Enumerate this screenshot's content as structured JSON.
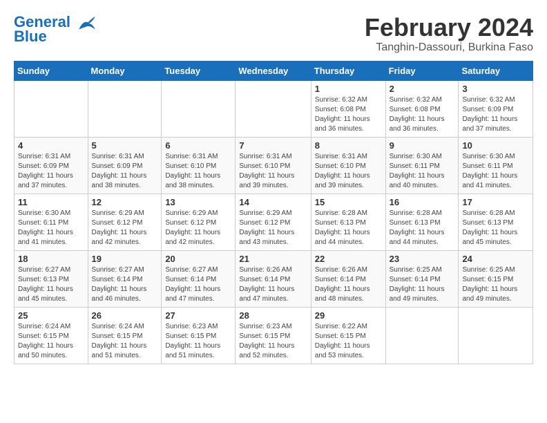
{
  "logo": {
    "line1": "General",
    "line2": "Blue"
  },
  "title": "February 2024",
  "subtitle": "Tanghin-Dassouri, Burkina Faso",
  "weekdays": [
    "Sunday",
    "Monday",
    "Tuesday",
    "Wednesday",
    "Thursday",
    "Friday",
    "Saturday"
  ],
  "weeks": [
    [
      {
        "day": "",
        "info": ""
      },
      {
        "day": "",
        "info": ""
      },
      {
        "day": "",
        "info": ""
      },
      {
        "day": "",
        "info": ""
      },
      {
        "day": "1",
        "info": "Sunrise: 6:32 AM\nSunset: 6:08 PM\nDaylight: 11 hours\nand 36 minutes."
      },
      {
        "day": "2",
        "info": "Sunrise: 6:32 AM\nSunset: 6:08 PM\nDaylight: 11 hours\nand 36 minutes."
      },
      {
        "day": "3",
        "info": "Sunrise: 6:32 AM\nSunset: 6:09 PM\nDaylight: 11 hours\nand 37 minutes."
      }
    ],
    [
      {
        "day": "4",
        "info": "Sunrise: 6:31 AM\nSunset: 6:09 PM\nDaylight: 11 hours\nand 37 minutes."
      },
      {
        "day": "5",
        "info": "Sunrise: 6:31 AM\nSunset: 6:09 PM\nDaylight: 11 hours\nand 38 minutes."
      },
      {
        "day": "6",
        "info": "Sunrise: 6:31 AM\nSunset: 6:10 PM\nDaylight: 11 hours\nand 38 minutes."
      },
      {
        "day": "7",
        "info": "Sunrise: 6:31 AM\nSunset: 6:10 PM\nDaylight: 11 hours\nand 39 minutes."
      },
      {
        "day": "8",
        "info": "Sunrise: 6:31 AM\nSunset: 6:10 PM\nDaylight: 11 hours\nand 39 minutes."
      },
      {
        "day": "9",
        "info": "Sunrise: 6:30 AM\nSunset: 6:11 PM\nDaylight: 11 hours\nand 40 minutes."
      },
      {
        "day": "10",
        "info": "Sunrise: 6:30 AM\nSunset: 6:11 PM\nDaylight: 11 hours\nand 41 minutes."
      }
    ],
    [
      {
        "day": "11",
        "info": "Sunrise: 6:30 AM\nSunset: 6:11 PM\nDaylight: 11 hours\nand 41 minutes."
      },
      {
        "day": "12",
        "info": "Sunrise: 6:29 AM\nSunset: 6:12 PM\nDaylight: 11 hours\nand 42 minutes."
      },
      {
        "day": "13",
        "info": "Sunrise: 6:29 AM\nSunset: 6:12 PM\nDaylight: 11 hours\nand 42 minutes."
      },
      {
        "day": "14",
        "info": "Sunrise: 6:29 AM\nSunset: 6:12 PM\nDaylight: 11 hours\nand 43 minutes."
      },
      {
        "day": "15",
        "info": "Sunrise: 6:28 AM\nSunset: 6:13 PM\nDaylight: 11 hours\nand 44 minutes."
      },
      {
        "day": "16",
        "info": "Sunrise: 6:28 AM\nSunset: 6:13 PM\nDaylight: 11 hours\nand 44 minutes."
      },
      {
        "day": "17",
        "info": "Sunrise: 6:28 AM\nSunset: 6:13 PM\nDaylight: 11 hours\nand 45 minutes."
      }
    ],
    [
      {
        "day": "18",
        "info": "Sunrise: 6:27 AM\nSunset: 6:13 PM\nDaylight: 11 hours\nand 45 minutes."
      },
      {
        "day": "19",
        "info": "Sunrise: 6:27 AM\nSunset: 6:14 PM\nDaylight: 11 hours\nand 46 minutes."
      },
      {
        "day": "20",
        "info": "Sunrise: 6:27 AM\nSunset: 6:14 PM\nDaylight: 11 hours\nand 47 minutes."
      },
      {
        "day": "21",
        "info": "Sunrise: 6:26 AM\nSunset: 6:14 PM\nDaylight: 11 hours\nand 47 minutes."
      },
      {
        "day": "22",
        "info": "Sunrise: 6:26 AM\nSunset: 6:14 PM\nDaylight: 11 hours\nand 48 minutes."
      },
      {
        "day": "23",
        "info": "Sunrise: 6:25 AM\nSunset: 6:14 PM\nDaylight: 11 hours\nand 49 minutes."
      },
      {
        "day": "24",
        "info": "Sunrise: 6:25 AM\nSunset: 6:15 PM\nDaylight: 11 hours\nand 49 minutes."
      }
    ],
    [
      {
        "day": "25",
        "info": "Sunrise: 6:24 AM\nSunset: 6:15 PM\nDaylight: 11 hours\nand 50 minutes."
      },
      {
        "day": "26",
        "info": "Sunrise: 6:24 AM\nSunset: 6:15 PM\nDaylight: 11 hours\nand 51 minutes."
      },
      {
        "day": "27",
        "info": "Sunrise: 6:23 AM\nSunset: 6:15 PM\nDaylight: 11 hours\nand 51 minutes."
      },
      {
        "day": "28",
        "info": "Sunrise: 6:23 AM\nSunset: 6:15 PM\nDaylight: 11 hours\nand 52 minutes."
      },
      {
        "day": "29",
        "info": "Sunrise: 6:22 AM\nSunset: 6:15 PM\nDaylight: 11 hours\nand 53 minutes."
      },
      {
        "day": "",
        "info": ""
      },
      {
        "day": "",
        "info": ""
      }
    ]
  ]
}
